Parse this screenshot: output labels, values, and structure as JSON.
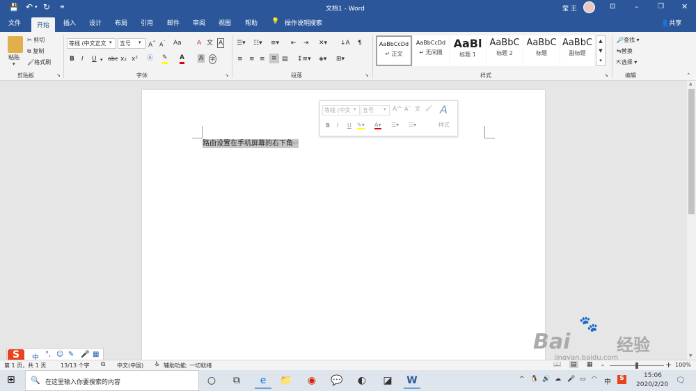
{
  "titlebar": {
    "doc_title": "文档1",
    "sep": "-",
    "app": "Word",
    "user": "莹 王",
    "icons": [
      "save-icon",
      "undo-icon",
      "redo-icon",
      "customize-icon"
    ]
  },
  "tabs": [
    "文件",
    "开始",
    "插入",
    "设计",
    "布局",
    "引用",
    "邮件",
    "审阅",
    "视图",
    "帮助"
  ],
  "active_tab": "开始",
  "tell_me": "操作说明搜索",
  "share": "共享",
  "clipboard": {
    "paste": "粘贴",
    "cut": "剪切",
    "copy": "复制",
    "format_painter": "格式刷",
    "label": "剪贴板"
  },
  "font": {
    "family": "等线 (中文正文",
    "size": "五号",
    "label": "字体",
    "aa": "Aa",
    "grow": "A",
    "shrink": "A",
    "bold": "B",
    "italic": "I",
    "underline": "U",
    "strike": "abc",
    "sub": "x₂",
    "sup": "x²",
    "font_color": "A",
    "shading": "A",
    "clear": "A",
    "wen": "文",
    "enclose": "字"
  },
  "paragraph": {
    "label": "段落"
  },
  "styles": {
    "label": "样式",
    "items": [
      {
        "preview": "AaBbCcDd",
        "name": "↵ 正文"
      },
      {
        "preview": "AaBbCcDd",
        "name": "↵ 无间隔"
      },
      {
        "preview": "AaBl",
        "name": "标题 1"
      },
      {
        "preview": "AaBbC",
        "name": "标题 2"
      },
      {
        "preview": "AaBbC",
        "name": "标题"
      },
      {
        "preview": "AaBbC",
        "name": "副标题"
      }
    ]
  },
  "editing": {
    "find": "查找",
    "replace": "替换",
    "select": "选择",
    "label": "编辑"
  },
  "document": {
    "text": "路由设置在手机屏幕的右下角",
    "mark": "↵"
  },
  "mini_toolbar": {
    "font": "等线 (中文",
    "size": "五号",
    "styles": "样式",
    "bold": "B",
    "italic": "I",
    "underline": "U"
  },
  "status": {
    "page": "第 1 页，共 1 页",
    "words": "13/13 个字",
    "lang": "中文(中国)",
    "access": "辅助功能: 一切就绪",
    "zoom": "100%",
    "minus": "-",
    "plus": "+"
  },
  "ime": {
    "items": [
      "中",
      "°,",
      "☺",
      "✎",
      "🎤",
      "▦"
    ]
  },
  "taskbar": {
    "search": "在这里输入你要搜索的内容",
    "time": "15:06",
    "date": "2020/2/20",
    "ime": "中"
  },
  "watermark": {
    "brand": "Bai",
    "suffix": "经验",
    "url": "jingyan.baidu.com"
  },
  "colors": {
    "accent": "#2b579a",
    "ribbon": "#f3f3f3",
    "highlight": "#c7c7c7"
  }
}
